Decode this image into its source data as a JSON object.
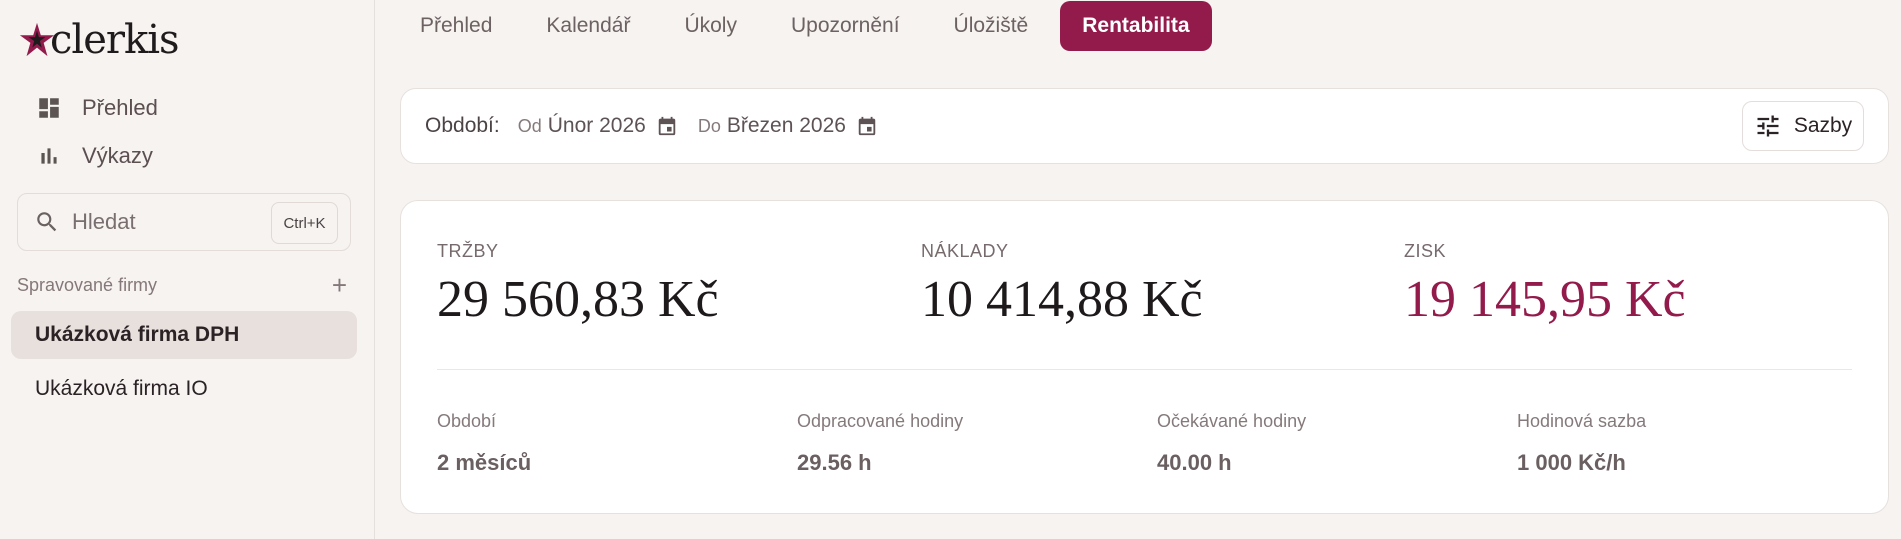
{
  "brand": {
    "logo_text": "clerkis",
    "accent": "#931b4c"
  },
  "sidebar": {
    "nav": [
      {
        "label": "Přehled",
        "icon": "dashboard-icon"
      },
      {
        "label": "Výkazy",
        "icon": "bar-chart-icon"
      }
    ],
    "search": {
      "placeholder": "Hledat",
      "shortcut": "Ctrl+K"
    },
    "section_title": "Spravované firmy",
    "firms": [
      {
        "label": "Ukázková firma DPH",
        "active": true
      },
      {
        "label": "Ukázková firma IO",
        "active": false
      }
    ]
  },
  "tabs": [
    {
      "label": "Přehled",
      "active": false
    },
    {
      "label": "Kalendář",
      "active": false
    },
    {
      "label": "Úkoly",
      "active": false
    },
    {
      "label": "Upozornění",
      "active": false
    },
    {
      "label": "Úložiště",
      "active": false
    },
    {
      "label": "Rentabilita",
      "active": true
    }
  ],
  "period": {
    "label": "Období:",
    "from_prefix": "Od",
    "from_value": "Únor 2026",
    "to_prefix": "Do",
    "to_value": "Březen 2026",
    "rates_button": "Sazby"
  },
  "summary": {
    "revenue": {
      "label": "TRŽBY",
      "value": "29 560,83 Kč"
    },
    "costs": {
      "label": "NÁKLADY",
      "value": "10 414,88 Kč"
    },
    "profit": {
      "label": "ZISK",
      "value": "19 145,95 Kč"
    }
  },
  "stats": [
    {
      "label": "Období",
      "value": "2 měsíců"
    },
    {
      "label": "Odpracované hodiny",
      "value": "29.56 h"
    },
    {
      "label": "Očekávané hodiny",
      "value": "40.00 h"
    },
    {
      "label": "Hodinová sazba",
      "value": "1 000 Kč/h"
    }
  ]
}
